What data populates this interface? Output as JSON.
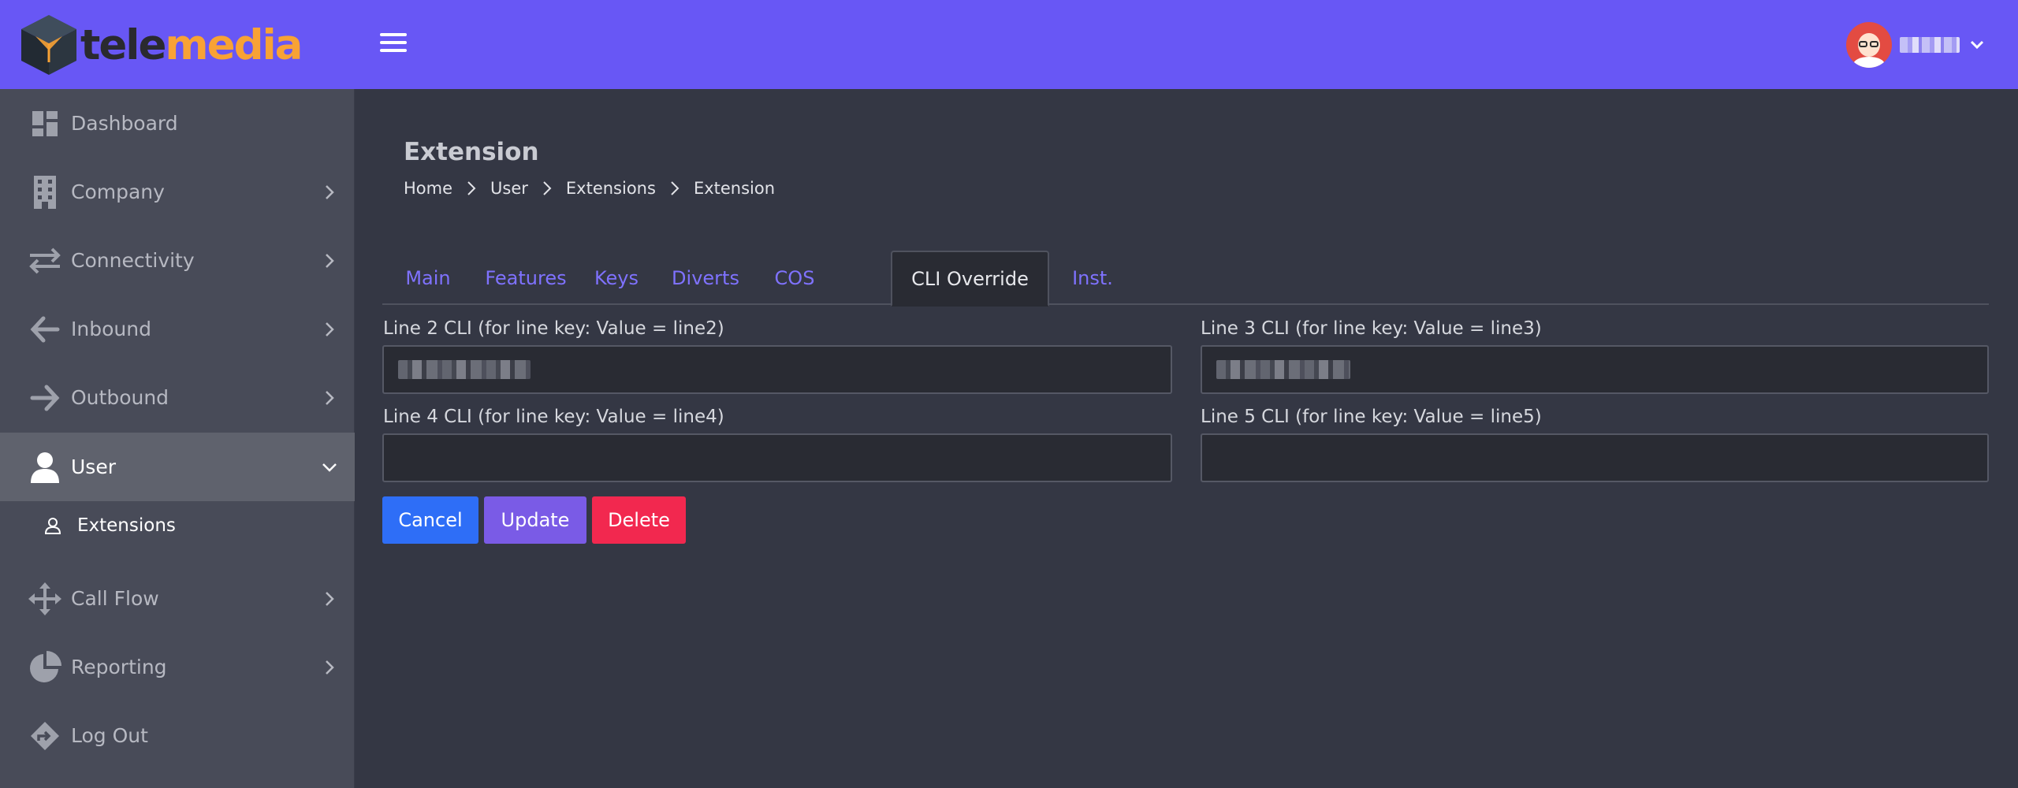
{
  "brand": {
    "name_part1": "tele",
    "name_part2": "media"
  },
  "header": {
    "user_name": "█████"
  },
  "sidebar": {
    "items": [
      {
        "label": "Dashboard",
        "icon": "dashboard-icon"
      },
      {
        "label": "Company",
        "icon": "building-icon"
      },
      {
        "label": "Connectivity",
        "icon": "arrows-exchange-icon"
      },
      {
        "label": "Inbound",
        "icon": "arrow-left-icon"
      },
      {
        "label": "Outbound",
        "icon": "arrow-right-icon"
      },
      {
        "label": "User",
        "icon": "user-icon"
      },
      {
        "label": "Call Flow",
        "icon": "move-arrows-icon"
      },
      {
        "label": "Reporting",
        "icon": "pie-chart-icon"
      },
      {
        "label": "Log Out",
        "icon": "sign-out-icon"
      }
    ],
    "sub_item": {
      "label": "Extensions",
      "icon": "user-outline-icon"
    },
    "active_item": "User"
  },
  "page": {
    "title": "Extension",
    "breadcrumb": [
      "Home",
      "User",
      "Extensions",
      "Extension"
    ]
  },
  "tabs": [
    {
      "label": "Main"
    },
    {
      "label": "Features"
    },
    {
      "label": "Keys"
    },
    {
      "label": "Diverts"
    },
    {
      "label": "COS"
    },
    {
      "label": "CLI Override"
    },
    {
      "label": "Inst."
    }
  ],
  "active_tab": "CLI Override",
  "form": {
    "line2": {
      "label": "Line 2 CLI (for line key: Value = line2)",
      "value": ""
    },
    "line3": {
      "label": "Line 3 CLI (for line key: Value = line3)",
      "value": ""
    },
    "line4": {
      "label": "Line 4 CLI (for line key: Value = line4)",
      "value": ""
    },
    "line5": {
      "label": "Line 5 CLI (for line key: Value = line5)",
      "value": ""
    }
  },
  "buttons": {
    "cancel": "Cancel",
    "update": "Update",
    "delete": "Delete"
  },
  "colors": {
    "topbar": "#6857f5",
    "sidebar": "#484b58",
    "content": "#343744",
    "tab_link": "#7f72ff",
    "cancel": "#2e6ef7",
    "update": "#7a5be6",
    "delete": "#f2284f",
    "logo_accent": "#f8a235"
  }
}
